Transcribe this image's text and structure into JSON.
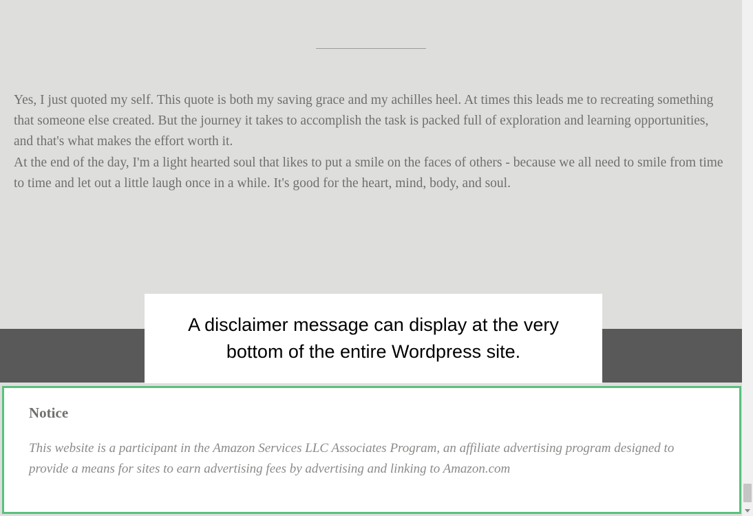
{
  "content": {
    "paragraph1": "Yes, I just quoted my self. This quote is both my saving grace and my achilles heel. At times this leads me to recreating something that someone else created. But the journey it takes to accomplish the task is packed full of exploration and learning opportunities, and that's what makes the effort worth it.",
    "paragraph2": "At the end of the day, I'm a light hearted soul that likes to put a smile on the faces of others - because we all need to smile from time to time and let out a little laugh once in a while. It's good for the heart, mind, body, and soul."
  },
  "annotation": {
    "text": "A disclaimer message can display at the very bottom of the entire Wordpress site."
  },
  "notice": {
    "heading": "Notice",
    "body": "This website is a participant in the Amazon Services LLC Associates Program, an affiliate advertising program designed to provide a means for sites to earn advertising fees by advertising and linking to Amazon.com"
  }
}
